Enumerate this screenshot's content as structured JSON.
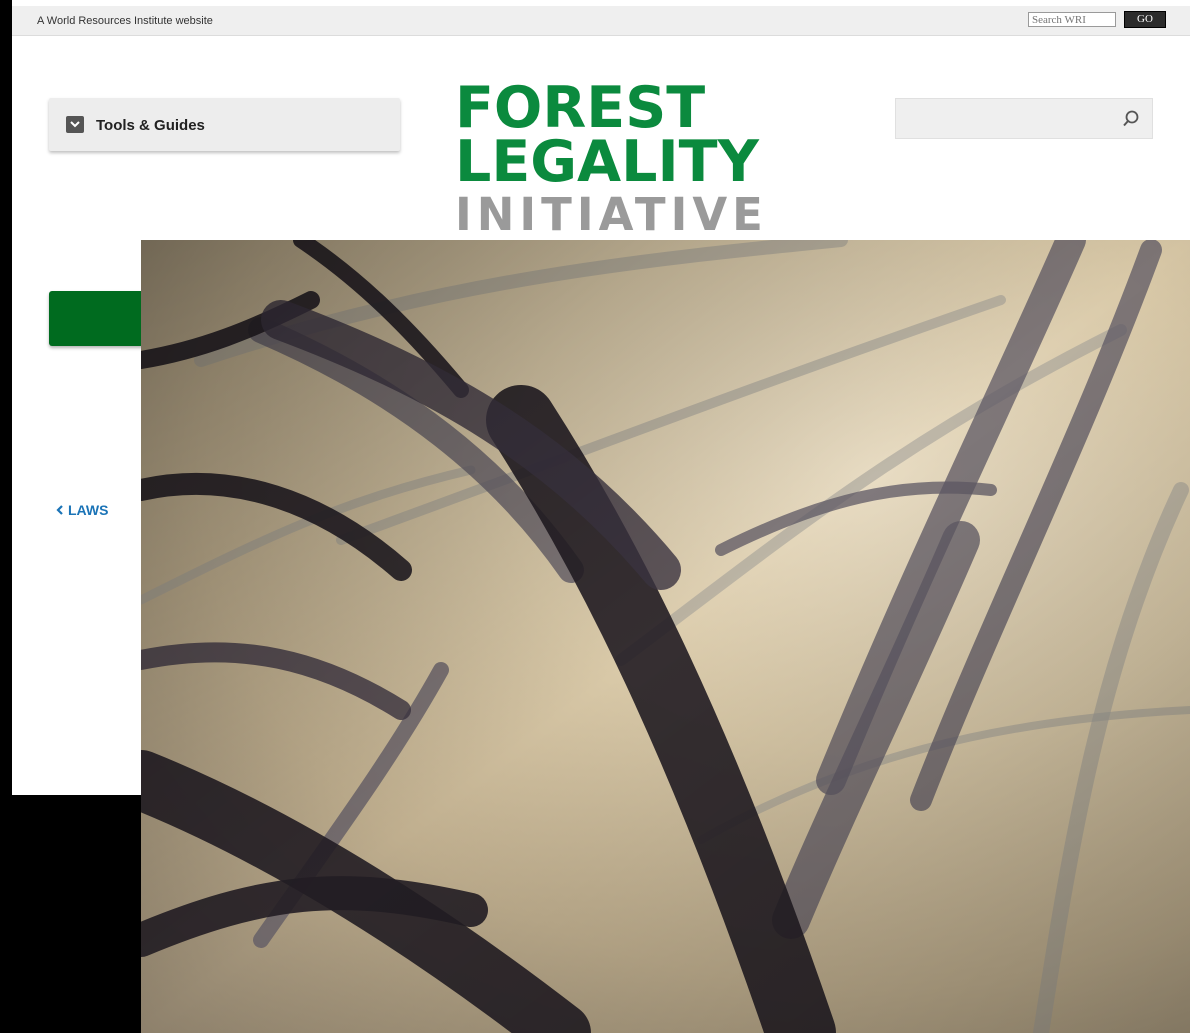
{
  "topbar": {
    "text": "A World Resources Institute website",
    "search_placeholder": "Search WRI",
    "go_label": "GO"
  },
  "nav": {
    "tools_label": "Tools & Guides"
  },
  "logo": {
    "line1": "FOREST",
    "line2": "LEGALITY",
    "line3": "INITIATIVE"
  },
  "breadcrumb": {
    "back_label": "LAWS"
  },
  "icons": {
    "tools_toggle": "chevron-down-icon",
    "search": "search-icon",
    "back": "chevron-left-icon"
  },
  "colors": {
    "brand_green": "#0b8a3e",
    "dark_green": "#006b1f",
    "logo_gray": "#9a9a9a",
    "link_blue": "#1b74b7"
  }
}
